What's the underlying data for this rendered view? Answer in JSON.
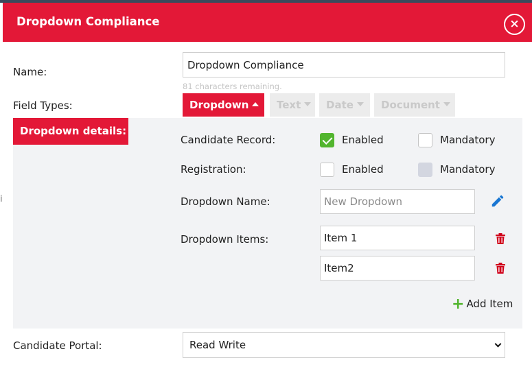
{
  "modal": {
    "title": "Dropdown Compliance",
    "close_label": "×"
  },
  "form": {
    "name_label": "Name:",
    "name_value": "Dropdown Compliance",
    "chars_remaining": "81 characters remaining.",
    "field_types_label": "Field Types:",
    "field_types": [
      {
        "label": "Dropdown",
        "state": "active"
      },
      {
        "label": "Text",
        "state": "disabled"
      },
      {
        "label": "Date",
        "state": "disabled"
      },
      {
        "label": "Document",
        "state": "disabled"
      }
    ]
  },
  "details": {
    "badge": "Dropdown details:",
    "candidate_record_label": "Candidate Record:",
    "registration_label": "Registration:",
    "enabled_label": "Enabled",
    "mandatory_label": "Mandatory",
    "candidate_record": {
      "enabled": true,
      "mandatory": false
    },
    "registration": {
      "enabled": false,
      "mandatory": false,
      "mandatory_disabled": true
    },
    "dropdown_name_label": "Dropdown Name:",
    "dropdown_name_placeholder": "New Dropdown",
    "dropdown_items_label": "Dropdown Items:",
    "items": [
      "Item 1",
      "Item2"
    ],
    "add_item_label": "Add Item",
    "add_item_symbol": "+"
  },
  "portal": {
    "label": "Candidate Portal:",
    "selected": "Read Write"
  },
  "background_fragment": "i",
  "colors": {
    "brand_red": "#e31837",
    "check_green": "#52b52e",
    "edit_blue": "#1976d2",
    "delete_red": "#d0021b",
    "panel_gray": "#f2f3f5"
  },
  "icons": {
    "close": "close-icon",
    "caret_up": "caret-up-icon",
    "caret_down": "caret-down-icon",
    "edit": "pencil-icon",
    "delete": "trash-icon",
    "add": "plus-icon",
    "select": "chevron-down-icon"
  }
}
